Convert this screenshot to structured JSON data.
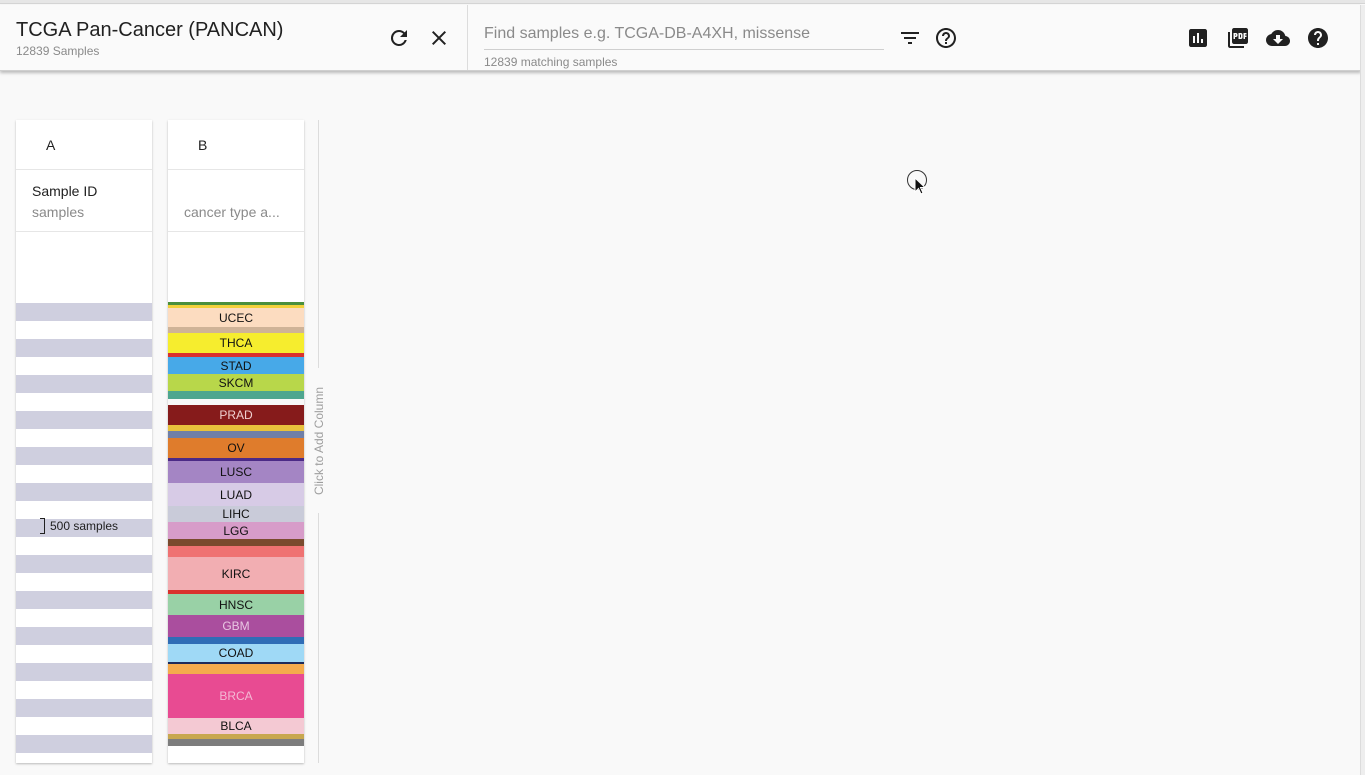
{
  "header": {
    "title": "TCGA Pan-Cancer (PANCAN)",
    "subtitle": "12839 Samples"
  },
  "search": {
    "placeholder": "Find samples e.g. TCGA-DB-A4XH, missense",
    "matching_text": "12839 matching samples"
  },
  "icons": {
    "refresh": "refresh-icon",
    "close": "close-icon",
    "filter": "filter-icon",
    "help_outline": "help-outline-icon",
    "chart": "bar-chart-icon",
    "pdf": "pdf-icon",
    "download": "cloud-download-icon",
    "help": "help-icon"
  },
  "columns": [
    {
      "letter": "A",
      "label": "Sample ID",
      "sub": "samples",
      "annotation": "500 samples"
    },
    {
      "letter": "B",
      "label": "",
      "sub": "cancer type a..."
    }
  ],
  "cancer_types": [
    {
      "label": "",
      "color": "#4a8f3c"
    },
    {
      "label": "",
      "color": "#f2d13a"
    },
    {
      "label": "UCEC",
      "color": "#fcdcc0"
    },
    {
      "label": "",
      "color": "#cfb397"
    },
    {
      "label": "THCA",
      "color": "#f6ed2e"
    },
    {
      "label": "",
      "color": "#d9312c"
    },
    {
      "label": "STAD",
      "color": "#47a9e8"
    },
    {
      "label": "SKCM",
      "color": "#b8d74a"
    },
    {
      "label": "",
      "color": "#4ea68f"
    },
    {
      "label": "",
      "color": "#f8f8f8"
    },
    {
      "label": "PRAD",
      "color": "#861b1b",
      "text": "#f0d0d0"
    },
    {
      "label": "",
      "color": "#e8c13c"
    },
    {
      "label": "",
      "color": "#6f7fa8"
    },
    {
      "label": "OV",
      "color": "#df7c2c"
    },
    {
      "label": "",
      "color": "#4b2a86"
    },
    {
      "label": "LUSC",
      "color": "#a485c4"
    },
    {
      "label": "LUAD",
      "color": "#d7cbe6"
    },
    {
      "label": "LIHC",
      "color": "#c9cbd9"
    },
    {
      "label": "LGG",
      "color": "#d79cc9"
    },
    {
      "label": "",
      "color": "#7a4a2e"
    },
    {
      "label": "",
      "color": "#ef7272"
    },
    {
      "label": "KIRC",
      "color": "#f2aeb2"
    },
    {
      "label": "",
      "color": "#d9312c"
    },
    {
      "label": "HNSC",
      "color": "#99d1a6"
    },
    {
      "label": "GBM",
      "color": "#aa4e9e",
      "text": "#e8c6e2"
    },
    {
      "label": "",
      "color": "#2f6db6"
    },
    {
      "label": "COAD",
      "color": "#9fd9f6"
    },
    {
      "label": "",
      "color": "#1c2a5a"
    },
    {
      "label": "",
      "color": "#f4ab4d"
    },
    {
      "label": "BRCA",
      "color": "#e84b92",
      "text": "#f3b9d4"
    },
    {
      "label": "BLCA",
      "color": "#f4c9d3"
    },
    {
      "label": "",
      "color": "#c8a74f"
    },
    {
      "label": "",
      "color": "#7d7d7d"
    }
  ],
  "add_column_label": "Click to Add Column"
}
